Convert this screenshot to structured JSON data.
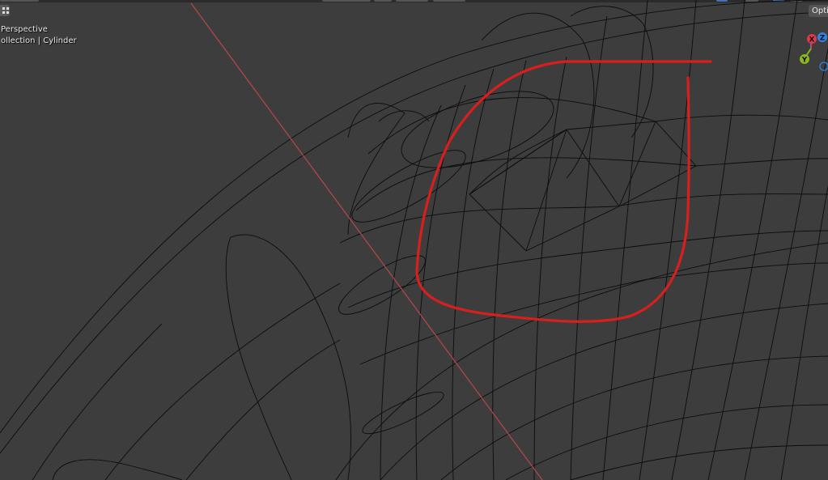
{
  "viewport": {
    "view_name": "Perspective",
    "collection_path": "ollection | Cylinder",
    "options_label": "Opti"
  },
  "gizmo": {
    "x_label": "X",
    "y_label": "Y",
    "z_label": "Z",
    "x_color": "#e0394e",
    "y_color": "#8ab71f",
    "z_color": "#2f83e6"
  },
  "colors": {
    "background": "#3d3d3d",
    "wire": "#0c0c0c",
    "x_axis_line": "#b7474f",
    "annotation": "#d7201e"
  }
}
